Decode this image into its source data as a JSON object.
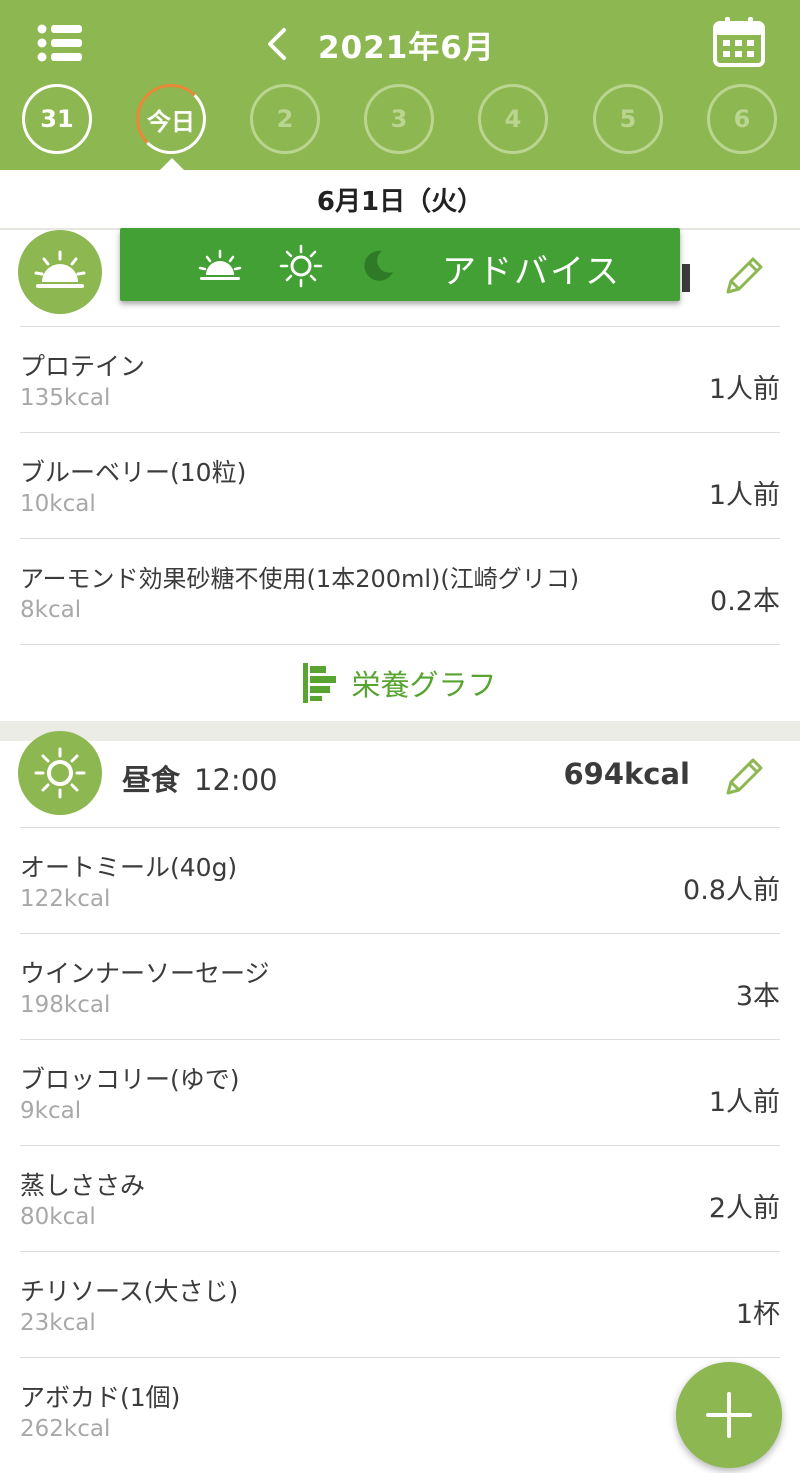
{
  "header": {
    "month_title": "2021年6月",
    "days": [
      {
        "label": "31",
        "state": "past"
      },
      {
        "label": "今日",
        "state": "today"
      },
      {
        "label": "2",
        "state": "future"
      },
      {
        "label": "3",
        "state": "future"
      },
      {
        "label": "4",
        "state": "future"
      },
      {
        "label": "5",
        "state": "future"
      },
      {
        "label": "6",
        "state": "future"
      }
    ]
  },
  "date_bar": {
    "label": "6月1日（火）"
  },
  "advice": {
    "label": "アドバイス"
  },
  "breakfast": {
    "items": [
      {
        "name": "プロテイン",
        "kcal": "135kcal",
        "qty": "1人前"
      },
      {
        "name": "ブルーベリー(10粒)",
        "kcal": "10kcal",
        "qty": "1人前"
      },
      {
        "name": "アーモンド効果砂糖不使用(1本200ml)(江崎グリコ)",
        "kcal": "8kcal",
        "qty": "0.2本"
      }
    ],
    "nutrition_label": "栄養グラフ"
  },
  "lunch": {
    "name": "昼食",
    "time": "12:00",
    "total_kcal": "694kcal",
    "items": [
      {
        "name": "オートミール(40g)",
        "kcal": "122kcal",
        "qty": "0.8人前"
      },
      {
        "name": "ウインナーソーセージ",
        "kcal": "198kcal",
        "qty": "3本"
      },
      {
        "name": "ブロッコリー(ゆで)",
        "kcal": "9kcal",
        "qty": "1人前"
      },
      {
        "name": "蒸しささみ",
        "kcal": "80kcal",
        "qty": "2人前"
      },
      {
        "name": "チリソース(大さじ)",
        "kcal": "23kcal",
        "qty": "1杯"
      },
      {
        "name": "アボカド(1個)",
        "kcal": "262kcal",
        "qty": ""
      }
    ]
  },
  "colors": {
    "header_green": "#8db750",
    "advice_green": "#43a034",
    "accent_orange": "#e8893a",
    "link_green": "#58a331"
  },
  "icons": [
    "menu-icon",
    "back-chevron-icon",
    "calendar-icon",
    "sunrise-icon",
    "sun-icon",
    "moon-icon",
    "pencil-icon",
    "bar-graph-icon",
    "plus-icon"
  ]
}
